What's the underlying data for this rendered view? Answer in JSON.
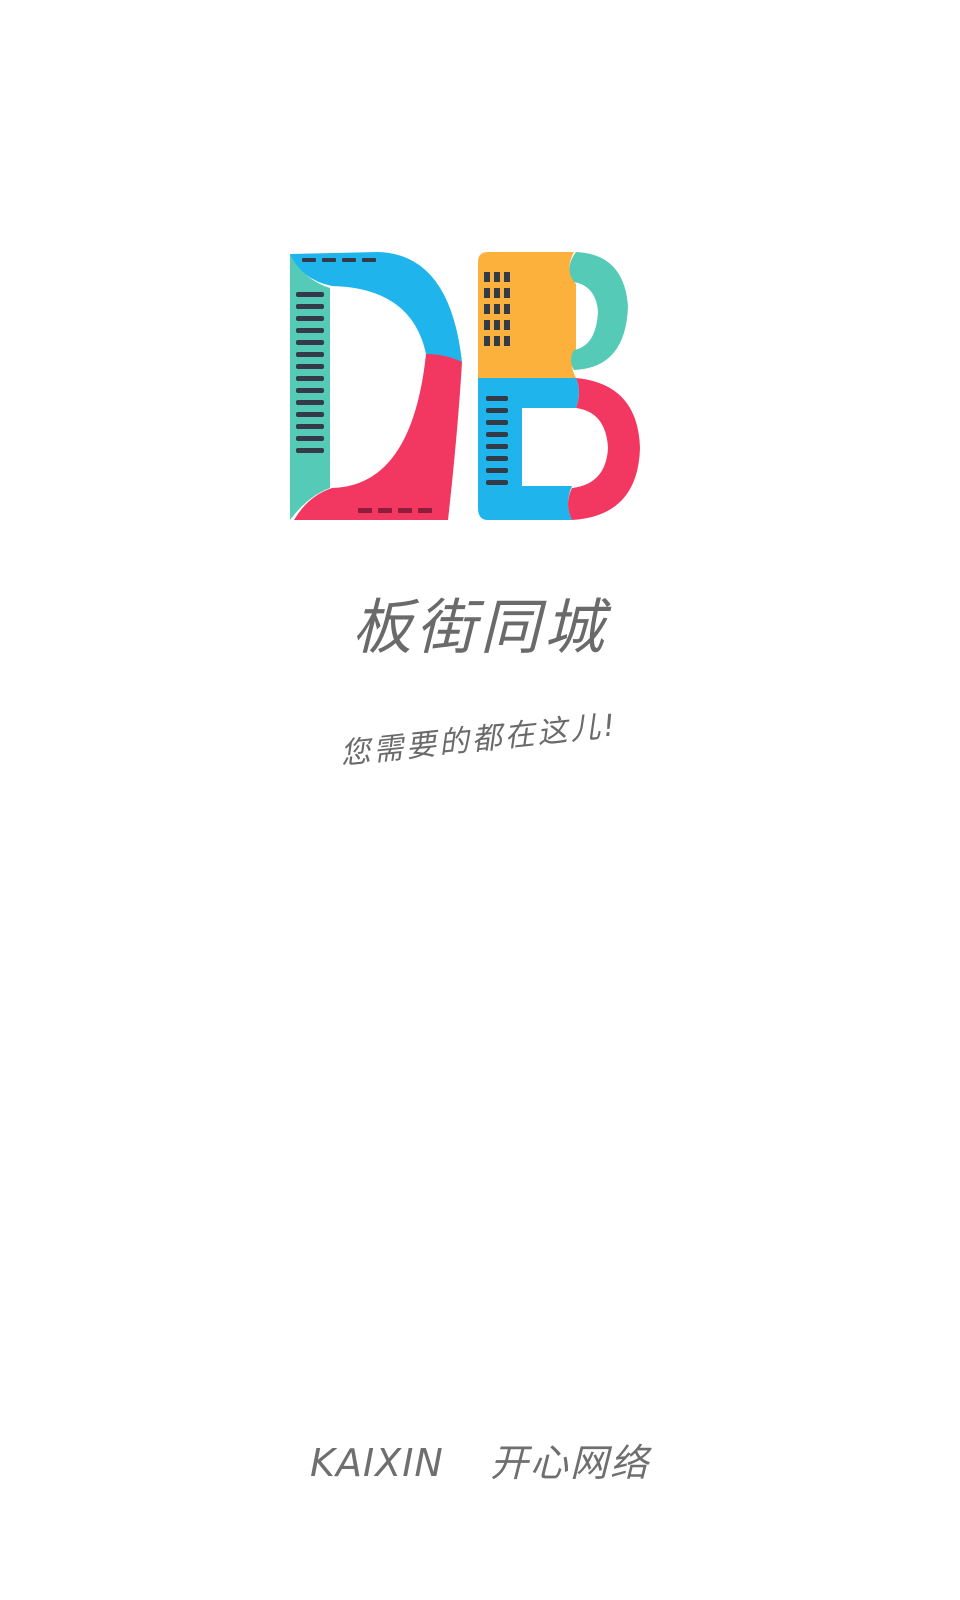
{
  "splash": {
    "app_name": "板街同城",
    "slogan": "您需要的都在这儿!",
    "footer": {
      "company_en": "KAIXIN",
      "company_cn": "开心网络"
    }
  },
  "colors": {
    "background": "#ffffff",
    "logo_blue": "#1fb5ec",
    "logo_teal": "#55cbb7",
    "logo_pink": "#f23861",
    "logo_orange": "#fbb13c",
    "logo_windows": "#333b48",
    "text_gray": "#6a6a6a"
  },
  "icons": {
    "logo": "db-letters-logo-icon"
  }
}
